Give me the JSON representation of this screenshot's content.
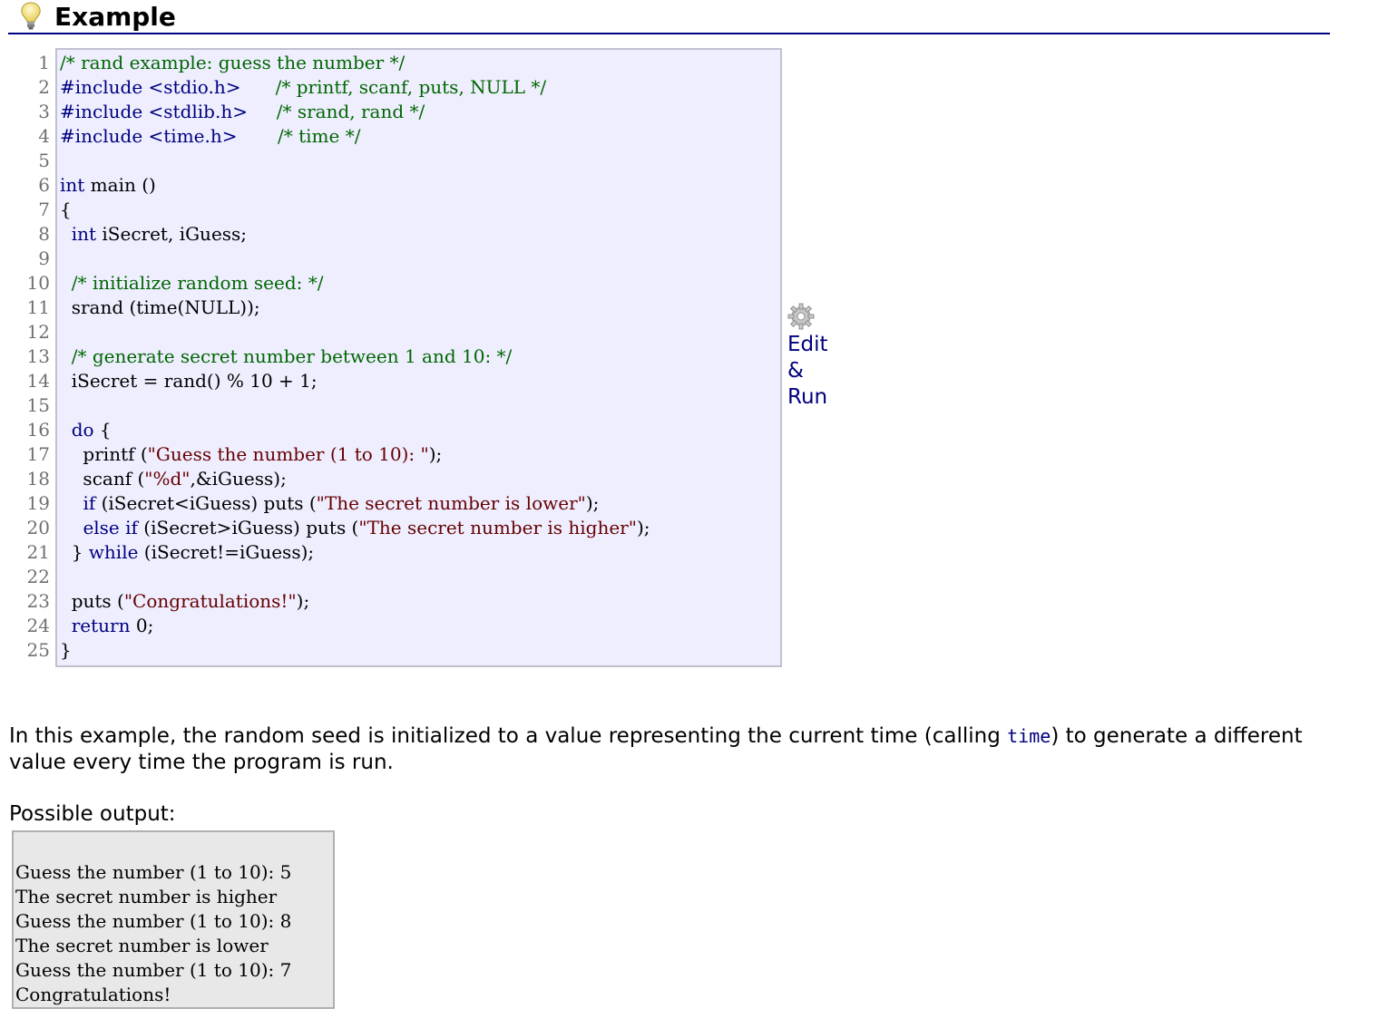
{
  "header": {
    "title": "Example",
    "icon": "lightbulb-icon"
  },
  "code": {
    "line_numbers": [
      "1",
      "2",
      "3",
      "4",
      "5",
      "6",
      "7",
      "8",
      "9",
      "10",
      "11",
      "12",
      "13",
      "14",
      "15",
      "16",
      "17",
      "18",
      "19",
      "20",
      "21",
      "22",
      "23",
      "24",
      "25"
    ],
    "lines": [
      "/* rand example: guess the number */",
      "#include <stdio.h>      /* printf, scanf, puts, NULL */",
      "#include <stdlib.h>     /* srand, rand */",
      "#include <time.h>       /* time */",
      "",
      "int main ()",
      "{",
      "  int iSecret, iGuess;",
      "",
      "  /* initialize random seed: */",
      "  srand (time(NULL));",
      "",
      "  /* generate secret number between 1 and 10: */",
      "  iSecret = rand() % 10 + 1;",
      "",
      "  do {",
      "    printf (\"Guess the number (1 to 10): \");",
      "    scanf (\"%d\",&iGuess);",
      "    if (iSecret<iGuess) puts (\"The secret number is lower\");",
      "    else if (iSecret>iGuess) puts (\"The secret number is higher\");",
      "  } while (iSecret!=iGuess);",
      "",
      "  puts (\"Congratulations!\");",
      "  return 0;",
      "}"
    ]
  },
  "edit_run": {
    "label": "Edit & Run",
    "icon": "gear-icon"
  },
  "description": {
    "before": "In this example, the random seed is initialized to a value representing the current time (calling ",
    "code": "time",
    "after": ") to generate a different value every time the program is run."
  },
  "possible_output_label": "Possible output:",
  "output": {
    "lines": [
      "Guess the number (1 to 10): 5",
      "The secret number is higher",
      "Guess the number (1 to 10): 8",
      "The secret number is lower",
      "Guess the number (1 to 10): 7",
      "Congratulations!"
    ]
  },
  "colors": {
    "code_bg": "#eeeeff",
    "comment": "#006600",
    "keyword": "#000080",
    "string": "#660000",
    "output_bg": "#e8e8e8",
    "link": "#000080"
  }
}
